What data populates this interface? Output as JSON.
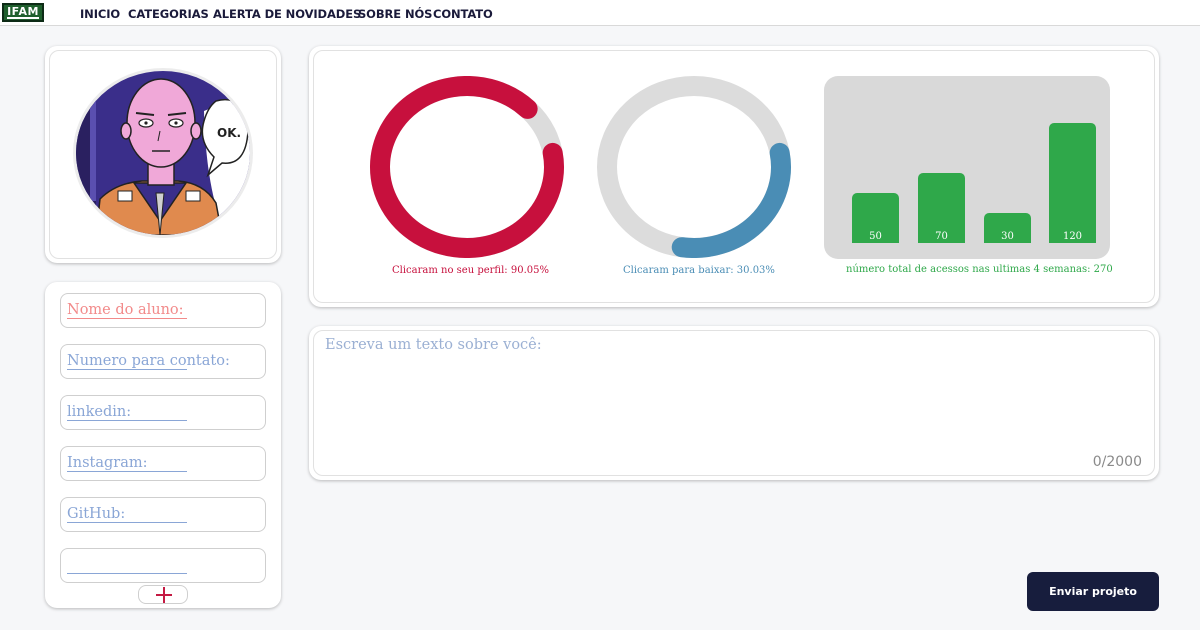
{
  "navbar": {
    "logo": "IFAM",
    "links": [
      "INICIO",
      "CATEGORIAS",
      "ALERTA DE NOVIDADES",
      "SOBRE NÓS",
      "CONTATO"
    ]
  },
  "profile": {
    "speech_bubble": "OK."
  },
  "form": {
    "fields": [
      "Nome do aluno:",
      "Numero para contato:",
      "linkedin:",
      "Instagram:",
      "GitHub:",
      ""
    ],
    "add_button_icon": "plus-icon"
  },
  "stats": {
    "profile_clicks": {
      "label": "Clicaram no seu perfil: 90.05%",
      "value": 90.05,
      "color": "#c7103d"
    },
    "downloads": {
      "label": "Clicaram para baixar: 30.03%",
      "value": 30.03,
      "color": "#4a8db5"
    },
    "ring_track_color": "#dcdcdc"
  },
  "chart_data": {
    "type": "bar",
    "categories": [
      "",
      "",
      "",
      ""
    ],
    "values": [
      50,
      70,
      30,
      120
    ],
    "title": "número total de acessos nas ultimas 4 semanas: 270",
    "bar_color": "#2fa84a",
    "title_color": "#2fa84a"
  },
  "about": {
    "placeholder": "Escreva um texto sobre você:",
    "counter": "0/2000"
  },
  "submit_label": "Enviar projeto"
}
